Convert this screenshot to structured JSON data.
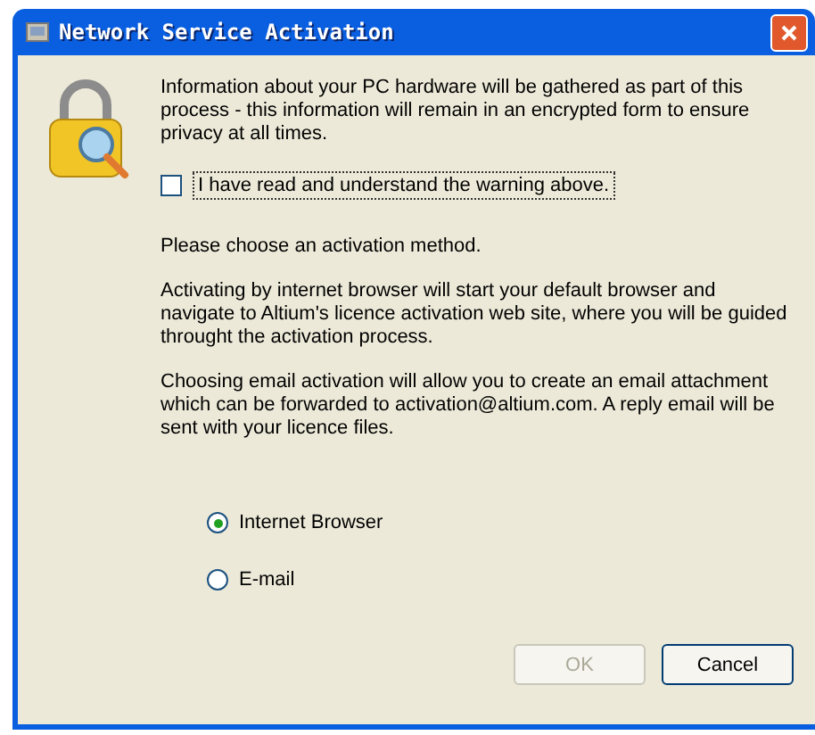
{
  "window": {
    "title": "Network Service Activation"
  },
  "intro": "Information about your PC hardware will be gathered as part of this process - this information will remain in an encrypted form to ensure privacy at all times.",
  "agree": {
    "label": "I have read and understand the warning above.",
    "checked": false
  },
  "paragraphs": [
    "Please choose an activation method.",
    "Activating by internet browser will start your default browser and navigate to Altium's licence activation web site, where you will be guided throught the activation process.",
    "Choosing email activation will allow you to create an email attachment which can be forwarded to activation@altium.com. A reply email will be sent with your licence files."
  ],
  "methods": [
    {
      "label": "Internet Browser",
      "selected": true
    },
    {
      "label": "E-mail",
      "selected": false
    }
  ],
  "buttons": [
    {
      "label": "OK",
      "disabled": true
    },
    {
      "label": "Cancel",
      "disabled": false
    }
  ]
}
